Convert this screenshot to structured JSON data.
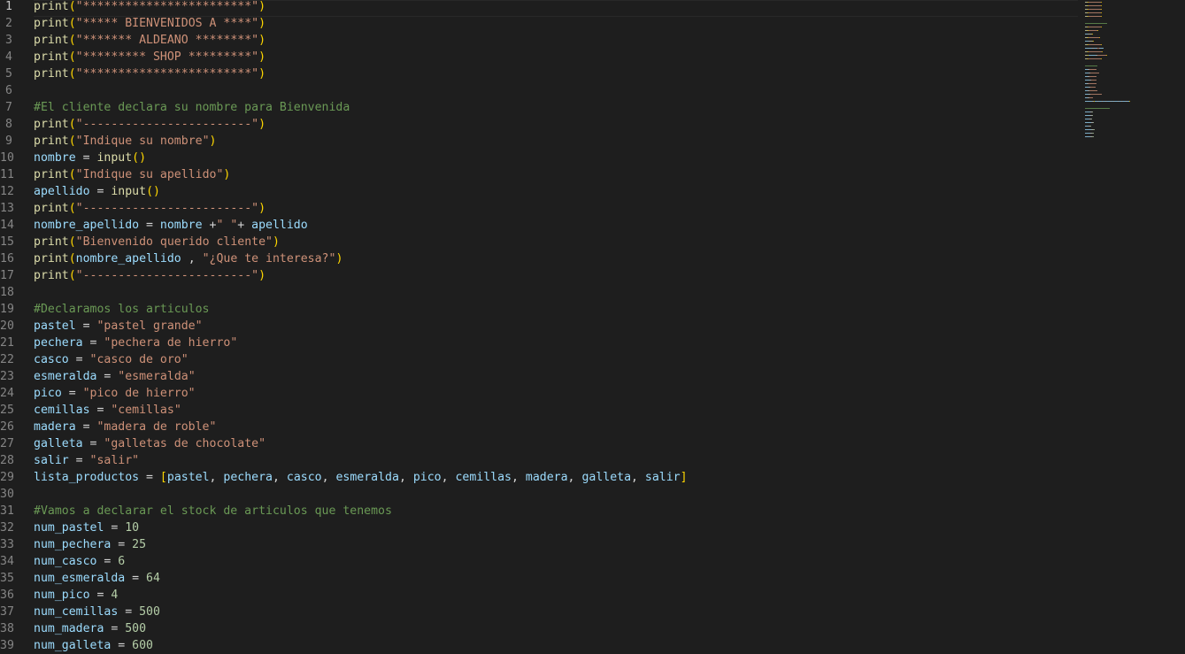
{
  "editor": {
    "active_line": 1,
    "lines": [
      {
        "n": "1",
        "tokens": [
          {
            "t": "print",
            "c": "fn"
          },
          {
            "t": "(",
            "c": "p1"
          },
          {
            "t": "\"************************\"",
            "c": "str"
          },
          {
            "t": ")",
            "c": "p1"
          }
        ]
      },
      {
        "n": "2",
        "tokens": [
          {
            "t": "print",
            "c": "fn"
          },
          {
            "t": "(",
            "c": "p1"
          },
          {
            "t": "\"***** BIENVENIDOS A ****\"",
            "c": "str"
          },
          {
            "t": ")",
            "c": "p1"
          }
        ]
      },
      {
        "n": "3",
        "tokens": [
          {
            "t": "print",
            "c": "fn"
          },
          {
            "t": "(",
            "c": "p1"
          },
          {
            "t": "\"******* ALDEANO ********\"",
            "c": "str"
          },
          {
            "t": ")",
            "c": "p1"
          }
        ]
      },
      {
        "n": "4",
        "tokens": [
          {
            "t": "print",
            "c": "fn"
          },
          {
            "t": "(",
            "c": "p1"
          },
          {
            "t": "\"********* SHOP *********\"",
            "c": "str"
          },
          {
            "t": ")",
            "c": "p1"
          }
        ]
      },
      {
        "n": "5",
        "tokens": [
          {
            "t": "print",
            "c": "fn"
          },
          {
            "t": "(",
            "c": "p1"
          },
          {
            "t": "\"************************\"",
            "c": "str"
          },
          {
            "t": ")",
            "c": "p1"
          }
        ]
      },
      {
        "n": "6",
        "tokens": []
      },
      {
        "n": "7",
        "tokens": [
          {
            "t": "#El cliente declara su nombre para Bienvenida",
            "c": "com"
          }
        ]
      },
      {
        "n": "8",
        "tokens": [
          {
            "t": "print",
            "c": "fn"
          },
          {
            "t": "(",
            "c": "p1"
          },
          {
            "t": "\"------------------------\"",
            "c": "str"
          },
          {
            "t": ")",
            "c": "p1"
          }
        ]
      },
      {
        "n": "9",
        "tokens": [
          {
            "t": "print",
            "c": "fn"
          },
          {
            "t": "(",
            "c": "p1"
          },
          {
            "t": "\"Indique su nombre\"",
            "c": "str"
          },
          {
            "t": ")",
            "c": "p1"
          }
        ]
      },
      {
        "n": "10",
        "tokens": [
          {
            "t": "nombre",
            "c": "var"
          },
          {
            "t": " = ",
            "c": "op"
          },
          {
            "t": "input",
            "c": "fn"
          },
          {
            "t": "()",
            "c": "p1"
          }
        ]
      },
      {
        "n": "11",
        "tokens": [
          {
            "t": "print",
            "c": "fn"
          },
          {
            "t": "(",
            "c": "p1"
          },
          {
            "t": "\"Indique su apellido\"",
            "c": "str"
          },
          {
            "t": ")",
            "c": "p1"
          }
        ]
      },
      {
        "n": "12",
        "tokens": [
          {
            "t": "apellido",
            "c": "var"
          },
          {
            "t": " = ",
            "c": "op"
          },
          {
            "t": "input",
            "c": "fn"
          },
          {
            "t": "()",
            "c": "p1"
          }
        ]
      },
      {
        "n": "13",
        "tokens": [
          {
            "t": "print",
            "c": "fn"
          },
          {
            "t": "(",
            "c": "p1"
          },
          {
            "t": "\"------------------------\"",
            "c": "str"
          },
          {
            "t": ")",
            "c": "p1"
          }
        ]
      },
      {
        "n": "14",
        "tokens": [
          {
            "t": "nombre_apellido",
            "c": "var"
          },
          {
            "t": " = ",
            "c": "op"
          },
          {
            "t": "nombre",
            "c": "var"
          },
          {
            "t": " +",
            "c": "op"
          },
          {
            "t": "\" \"",
            "c": "str"
          },
          {
            "t": "+ ",
            "c": "op"
          },
          {
            "t": "apellido",
            "c": "var"
          }
        ]
      },
      {
        "n": "15",
        "tokens": [
          {
            "t": "print",
            "c": "fn"
          },
          {
            "t": "(",
            "c": "p1"
          },
          {
            "t": "\"Bienvenido querido cliente\"",
            "c": "str"
          },
          {
            "t": ")",
            "c": "p1"
          }
        ]
      },
      {
        "n": "16",
        "tokens": [
          {
            "t": "print",
            "c": "fn"
          },
          {
            "t": "(",
            "c": "p1"
          },
          {
            "t": "nombre_apellido",
            "c": "var"
          },
          {
            "t": " , ",
            "c": "op"
          },
          {
            "t": "\"¿Que te interesa?\"",
            "c": "str"
          },
          {
            "t": ")",
            "c": "p1"
          }
        ]
      },
      {
        "n": "17",
        "tokens": [
          {
            "t": "print",
            "c": "fn"
          },
          {
            "t": "(",
            "c": "p1"
          },
          {
            "t": "\"------------------------\"",
            "c": "str"
          },
          {
            "t": ")",
            "c": "p1"
          }
        ]
      },
      {
        "n": "18",
        "tokens": []
      },
      {
        "n": "19",
        "tokens": [
          {
            "t": "#Declaramos los articulos",
            "c": "com"
          }
        ]
      },
      {
        "n": "20",
        "tokens": [
          {
            "t": "pastel",
            "c": "var"
          },
          {
            "t": " = ",
            "c": "op"
          },
          {
            "t": "\"pastel grande\"",
            "c": "str"
          }
        ]
      },
      {
        "n": "21",
        "tokens": [
          {
            "t": "pechera",
            "c": "var"
          },
          {
            "t": " = ",
            "c": "op"
          },
          {
            "t": "\"pechera de hierro\"",
            "c": "str"
          }
        ]
      },
      {
        "n": "22",
        "tokens": [
          {
            "t": "casco",
            "c": "var"
          },
          {
            "t": " = ",
            "c": "op"
          },
          {
            "t": "\"casco de oro\"",
            "c": "str"
          }
        ]
      },
      {
        "n": "23",
        "tokens": [
          {
            "t": "esmeralda",
            "c": "var"
          },
          {
            "t": " = ",
            "c": "op"
          },
          {
            "t": "\"esmeralda\"",
            "c": "str"
          }
        ]
      },
      {
        "n": "24",
        "tokens": [
          {
            "t": "pico",
            "c": "var"
          },
          {
            "t": " = ",
            "c": "op"
          },
          {
            "t": "\"pico de hierro\"",
            "c": "str"
          }
        ]
      },
      {
        "n": "25",
        "tokens": [
          {
            "t": "cemillas",
            "c": "var"
          },
          {
            "t": " = ",
            "c": "op"
          },
          {
            "t": "\"cemillas\"",
            "c": "str"
          }
        ]
      },
      {
        "n": "26",
        "tokens": [
          {
            "t": "madera",
            "c": "var"
          },
          {
            "t": " = ",
            "c": "op"
          },
          {
            "t": "\"madera de roble\"",
            "c": "str"
          }
        ]
      },
      {
        "n": "27",
        "tokens": [
          {
            "t": "galleta",
            "c": "var"
          },
          {
            "t": " = ",
            "c": "op"
          },
          {
            "t": "\"galletas de chocolate\"",
            "c": "str"
          }
        ]
      },
      {
        "n": "28",
        "tokens": [
          {
            "t": "salir",
            "c": "var"
          },
          {
            "t": " = ",
            "c": "op"
          },
          {
            "t": "\"salir\"",
            "c": "str"
          }
        ]
      },
      {
        "n": "29",
        "tokens": [
          {
            "t": "lista_productos",
            "c": "var"
          },
          {
            "t": " = ",
            "c": "op"
          },
          {
            "t": "[",
            "c": "p1"
          },
          {
            "t": "pastel",
            "c": "var"
          },
          {
            "t": ", ",
            "c": "op"
          },
          {
            "t": "pechera",
            "c": "var"
          },
          {
            "t": ", ",
            "c": "op"
          },
          {
            "t": "casco",
            "c": "var"
          },
          {
            "t": ", ",
            "c": "op"
          },
          {
            "t": "esmeralda",
            "c": "var"
          },
          {
            "t": ", ",
            "c": "op"
          },
          {
            "t": "pico",
            "c": "var"
          },
          {
            "t": ", ",
            "c": "op"
          },
          {
            "t": "cemillas",
            "c": "var"
          },
          {
            "t": ", ",
            "c": "op"
          },
          {
            "t": "madera",
            "c": "var"
          },
          {
            "t": ", ",
            "c": "op"
          },
          {
            "t": "galleta",
            "c": "var"
          },
          {
            "t": ", ",
            "c": "op"
          },
          {
            "t": "salir",
            "c": "var"
          },
          {
            "t": "]",
            "c": "p1"
          }
        ]
      },
      {
        "n": "30",
        "tokens": []
      },
      {
        "n": "31",
        "tokens": [
          {
            "t": "#Vamos a declarar el stock de articulos que tenemos",
            "c": "com"
          }
        ]
      },
      {
        "n": "32",
        "tokens": [
          {
            "t": "num_pastel",
            "c": "var"
          },
          {
            "t": " = ",
            "c": "op"
          },
          {
            "t": "10",
            "c": "num"
          }
        ]
      },
      {
        "n": "33",
        "tokens": [
          {
            "t": "num_pechera",
            "c": "var"
          },
          {
            "t": " = ",
            "c": "op"
          },
          {
            "t": "25",
            "c": "num"
          }
        ]
      },
      {
        "n": "34",
        "tokens": [
          {
            "t": "num_casco",
            "c": "var"
          },
          {
            "t": " = ",
            "c": "op"
          },
          {
            "t": "6",
            "c": "num"
          }
        ]
      },
      {
        "n": "35",
        "tokens": [
          {
            "t": "num_esmeralda",
            "c": "var"
          },
          {
            "t": " = ",
            "c": "op"
          },
          {
            "t": "64",
            "c": "num"
          }
        ]
      },
      {
        "n": "36",
        "tokens": [
          {
            "t": "num_pico",
            "c": "var"
          },
          {
            "t": " = ",
            "c": "op"
          },
          {
            "t": "4",
            "c": "num"
          }
        ]
      },
      {
        "n": "37",
        "tokens": [
          {
            "t": "num_cemillas",
            "c": "var"
          },
          {
            "t": " = ",
            "c": "op"
          },
          {
            "t": "500",
            "c": "num"
          }
        ]
      },
      {
        "n": "38",
        "tokens": [
          {
            "t": "num_madera",
            "c": "var"
          },
          {
            "t": " = ",
            "c": "op"
          },
          {
            "t": "500",
            "c": "num"
          }
        ]
      },
      {
        "n": "39",
        "tokens": [
          {
            "t": "num_galleta",
            "c": "var"
          },
          {
            "t": " = ",
            "c": "op"
          },
          {
            "t": "600",
            "c": "num"
          }
        ]
      }
    ]
  },
  "colors": {
    "background": "#1e1e1e",
    "function": "#dcdcaa",
    "string": "#ce9178",
    "variable": "#9cdcfe",
    "number": "#b5cea8",
    "comment": "#6a9955",
    "bracket": "#ffd700",
    "line_number": "#858585"
  }
}
